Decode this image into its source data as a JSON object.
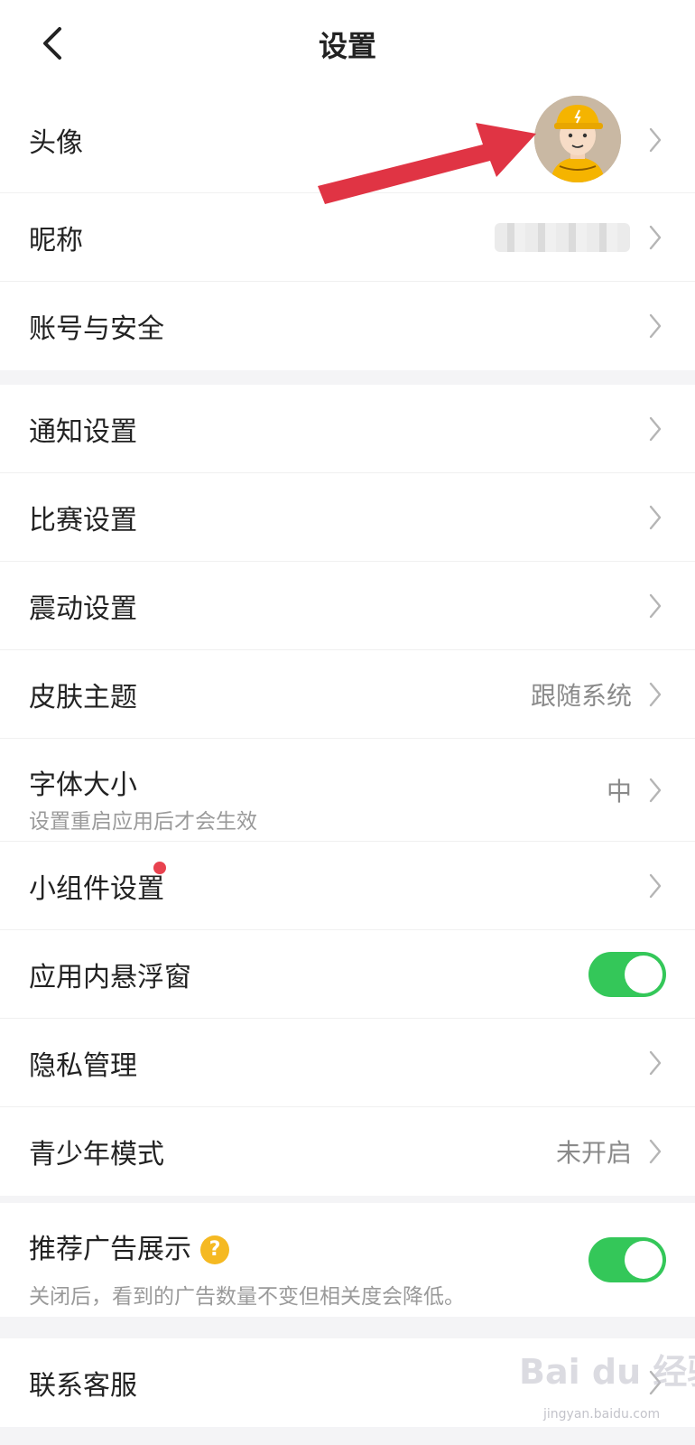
{
  "header": {
    "title": "设置"
  },
  "profile": {
    "avatar_label": "头像",
    "nickname_label": "昵称",
    "account_label": "账号与安全"
  },
  "settings": {
    "notifications_label": "通知设置",
    "match_label": "比赛设置",
    "vibration_label": "震动设置",
    "skin_label": "皮肤主题",
    "skin_value": "跟随系统",
    "font_label": "字体大小",
    "font_sub": "设置重启应用后才会生效",
    "font_value": "中",
    "widget_label": "小组件设置",
    "float_label": "应用内悬浮窗",
    "float_on": true,
    "privacy_label": "隐私管理",
    "teen_label": "青少年模式",
    "teen_value": "未开启"
  },
  "ads": {
    "label": "推荐广告展示",
    "sub": "关闭后，看到的广告数量不变但相关度会降低。",
    "help": "?",
    "on": true
  },
  "support": {
    "label": "联系客服"
  },
  "watermark": {
    "text": "Bai du 经验",
    "url": "jingyan.baidu.com"
  },
  "colors": {
    "toggle_on": "#34c759",
    "badge": "#e8424f",
    "help": "#f5b922",
    "arrow": "#e03444"
  },
  "icons": [
    "back-icon",
    "chevron-right-icon",
    "avatar-image",
    "question-icon",
    "red-arrow-annotation"
  ]
}
